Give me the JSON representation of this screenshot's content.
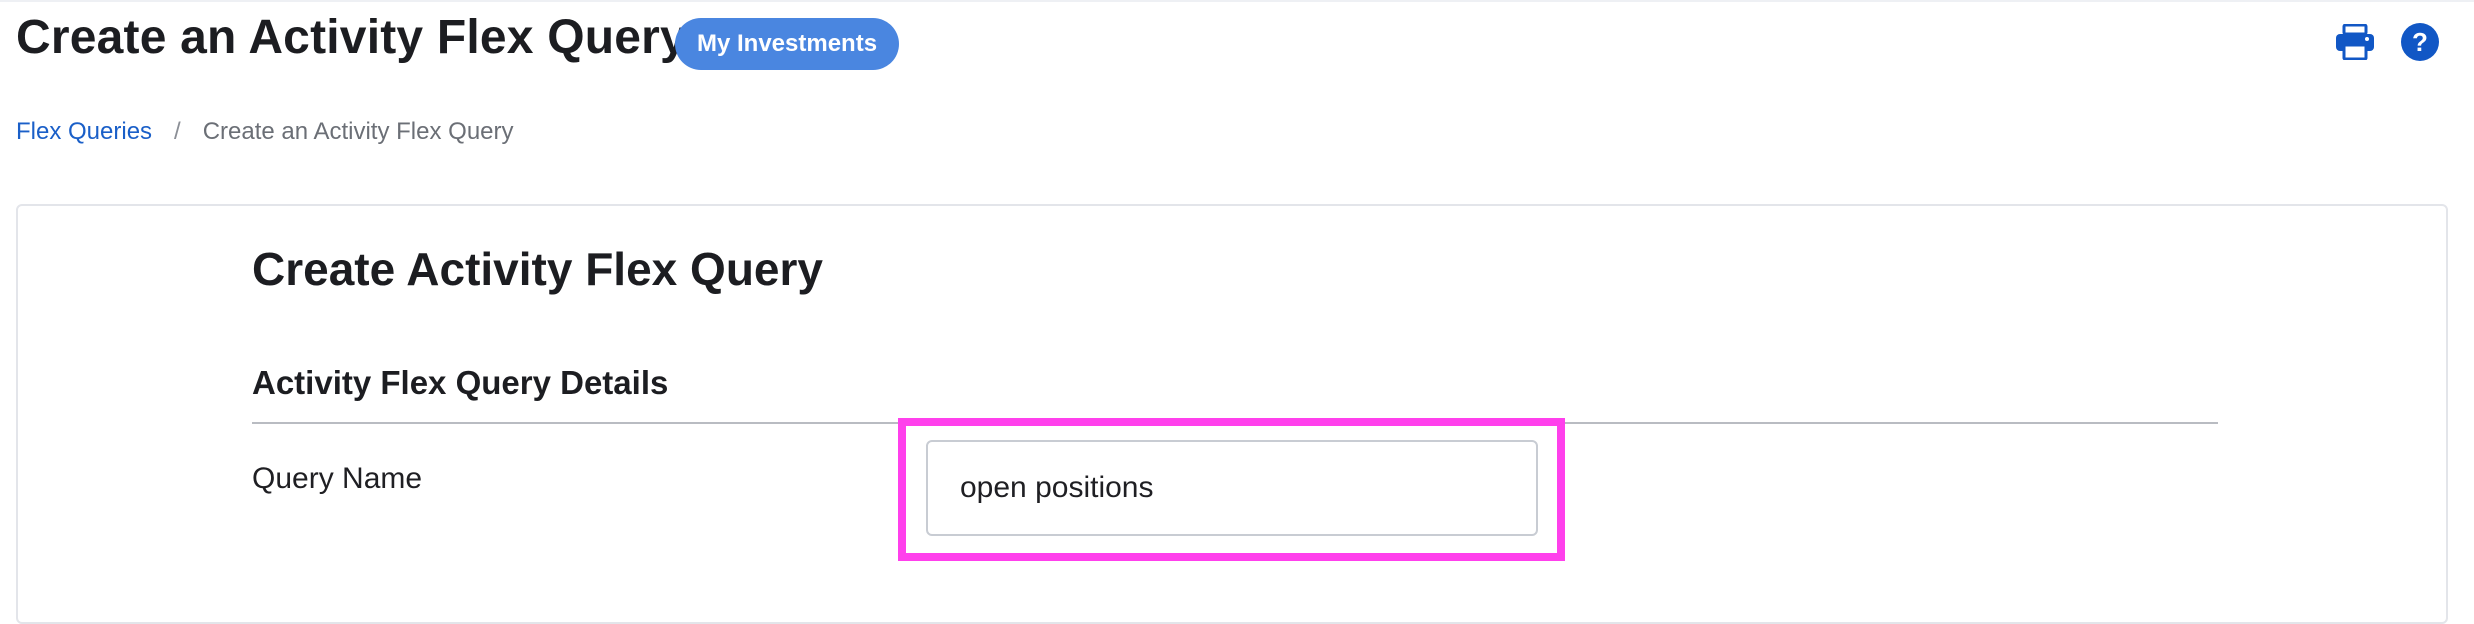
{
  "header": {
    "title": "Create an Activity Flex Query",
    "badge_label": "My Investments",
    "icons": [
      "printer-icon",
      "help-icon"
    ],
    "help_glyph": "?"
  },
  "breadcrumb": {
    "items": [
      {
        "label": "Flex Queries",
        "link": true
      },
      {
        "label": "Create an Activity Flex Query",
        "link": false
      }
    ],
    "separator": "/"
  },
  "form": {
    "title": "Create Activity Flex Query",
    "section_title": "Activity Flex Query Details",
    "query_name_label": "Query Name",
    "query_name_value": "open positions"
  },
  "colors": {
    "accent": "#1157c5",
    "badge": "#4a86e0",
    "link": "#1a5fc8",
    "highlight": "#ff40ec"
  }
}
